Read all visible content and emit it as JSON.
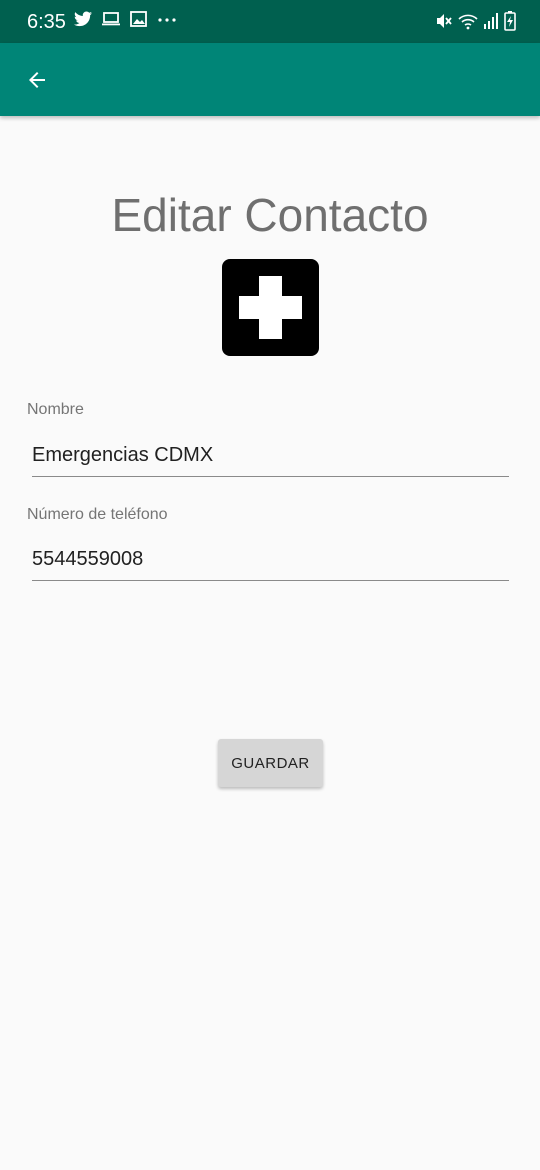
{
  "status_bar": {
    "time": "6:35",
    "left_icons": [
      "twitter-icon",
      "laptop-icon",
      "image-icon",
      "more-dots-icon"
    ],
    "right_icons": [
      "mute-icon",
      "wifi-icon",
      "signal-icon",
      "battery-charging-icon"
    ]
  },
  "app_bar": {
    "back_icon": "arrow-back-icon",
    "background": "#008577",
    "status_background": "#00604f"
  },
  "page": {
    "title": "Editar Contacto",
    "contact_icon": "first-aid-cross-icon"
  },
  "form": {
    "name_label": "Nombre",
    "name_value": "Emergencias CDMX",
    "phone_label": "Número de teléfono",
    "phone_value": "5544559008"
  },
  "actions": {
    "save_label": "GUARDAR"
  }
}
